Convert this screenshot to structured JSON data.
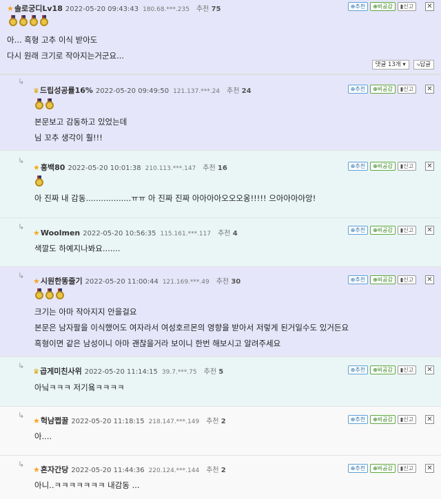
{
  "comments": [
    {
      "nick": "솔로궁디Lv18",
      "date": "2022-05-20 09:43:43",
      "ip": "180.68.***.235",
      "rec_label": "추천",
      "rec_count": "75",
      "medals": 4,
      "lines": [
        "아... 흑형 고추 이식 받아도",
        "다시 원래 크기로 작아지는거군요..."
      ],
      "btn_up": "추천",
      "btn_down": "비공감",
      "btn_report": "신고",
      "close": "✕",
      "reply_count": "댓글 13개",
      "reply_write": "답글"
    },
    {
      "nick": "드립성공률16%",
      "date": "2022-05-20 09:49:50",
      "ip": "121.137.***.24",
      "rec_label": "추천",
      "rec_count": "24",
      "medals": 2,
      "lines": [
        "본문보고 감동하고 있었는데",
        "님 꼬추 생각이 훨!!!"
      ],
      "btn_up": "추천",
      "btn_down": "비공감",
      "btn_report": "신고",
      "close": "✕"
    },
    {
      "nick": "흥백80",
      "date": "2022-05-20 10:01:38",
      "ip": "210.113.***.147",
      "rec_label": "추천",
      "rec_count": "16",
      "medals": 1,
      "lines": [
        "아 진짜 내 감동..................ㅠㅠ 아 진짜 진짜 아아아아오오오옹!!!!! 으아아아아앙!"
      ],
      "btn_up": "추천",
      "btn_down": "비공감",
      "btn_report": "신고",
      "close": "✕"
    },
    {
      "nick": "Woolmen",
      "date": "2022-05-20 10:56:35",
      "ip": "115.161.***.117",
      "rec_label": "추천",
      "rec_count": "4",
      "medals": 0,
      "lines": [
        "색깔도 하예지나봐요......."
      ],
      "btn_up": "추천",
      "btn_down": "비공감",
      "btn_report": "신고",
      "close": "✕"
    },
    {
      "nick": "시원한똥줄기",
      "date": "2022-05-20 11:00:44",
      "ip": "121.169.***.49",
      "rec_label": "추천",
      "rec_count": "30",
      "medals": 3,
      "lines": [
        "크기는 아마 작아지지 안을걸요",
        "본문은 남자팔을 이식했어도 여자라서 여성호르몬의 영향을 받아서 저렇게 된거일수도 있거든요",
        "흑형이면 같은 남성이니 아마 괜찮을거라 보이니 한번 해보시고 알려주세요"
      ],
      "btn_up": "추천",
      "btn_down": "비공감",
      "btn_report": "신고",
      "close": "✕"
    },
    {
      "nick": "곱게미친사위",
      "date": "2022-05-20 11:14:15",
      "ip": "39.7.***.75",
      "rec_label": "추천",
      "rec_count": "5",
      "medals": 0,
      "lines": [
        "아닠ㅋㅋㅋ 저기욬ㅋㅋㅋㅋ"
      ],
      "btn_up": "추천",
      "btn_down": "비공감",
      "btn_report": "신고",
      "close": "✕"
    },
    {
      "nick": "헉남쩝꿀",
      "date": "2022-05-20 11:18:15",
      "ip": "218.147.***.149",
      "rec_label": "추천",
      "rec_count": "2",
      "medals": 0,
      "lines": [
        "아...."
      ],
      "btn_up": "추천",
      "btn_down": "비공감",
      "btn_report": "신고",
      "close": "✕"
    },
    {
      "nick": "혼자간당",
      "date": "2022-05-20 11:44:36",
      "ip": "220.124.***.144",
      "rec_label": "추천",
      "rec_count": "2",
      "medals": 0,
      "lines": [
        "아니..ㅋㅋㅋㅋㅋㅋㅋ 내감동 ..."
      ],
      "btn_up": "추천",
      "btn_down": "비공감",
      "btn_report": "신고",
      "close": "✕"
    }
  ],
  "colors": {
    "purple_row": "#e6e6fa",
    "teal_row": "#eaf6f6",
    "white_row": "#f9f9f9",
    "star": "#f5a623",
    "recommend_btn": "#2d6fa8",
    "dislike_btn": "#2f7d14"
  },
  "icons": {
    "badge": "star-icon",
    "badge_alt": "crown-icon",
    "medal": "medal-icon",
    "reply": "reply-arrow-icon",
    "close": "close-icon"
  }
}
